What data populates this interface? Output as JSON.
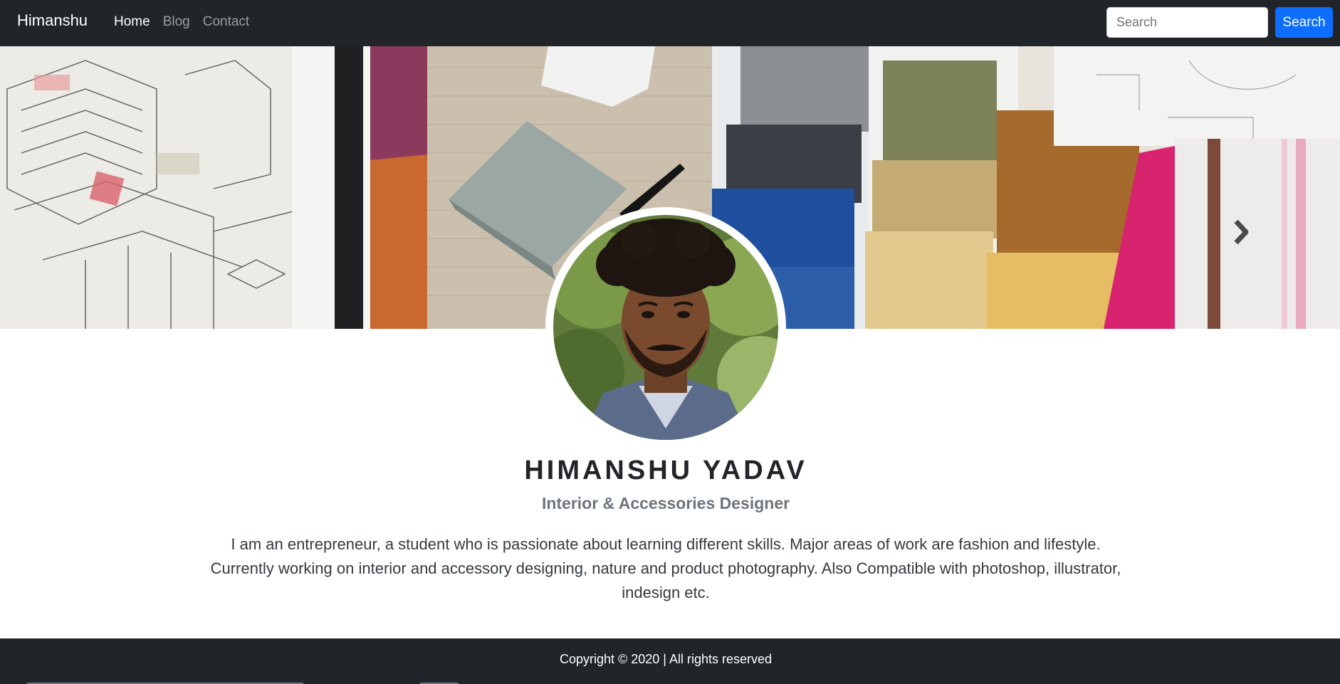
{
  "navbar": {
    "brand": "Himanshu",
    "links": [
      {
        "label": "Home",
        "active": true
      },
      {
        "label": "Blog",
        "active": false
      },
      {
        "label": "Contact",
        "active": false
      }
    ],
    "search": {
      "placeholder": "Search",
      "value": "",
      "button_label": "Search"
    }
  },
  "banner": {
    "prev_icon": "chevron-left-icon",
    "next_icon": "chevron-right-icon"
  },
  "profile": {
    "name": "HIMANSHU YADAV",
    "role": "Interior & Accessories Designer",
    "bio": "I am an entrepreneur, a student who is passionate about learning different skills. Major areas of work are fashion and lifestyle. Currently working on interior and accessory designing, nature and product photography. Also Compatible with photoshop, illustrator, indesign etc."
  },
  "footer": {
    "text": "Copyright © 2020 | All rights reserved"
  },
  "colors": {
    "navbar_bg": "#212529",
    "accent": "#0d6efd",
    "muted": "#6c757d"
  }
}
